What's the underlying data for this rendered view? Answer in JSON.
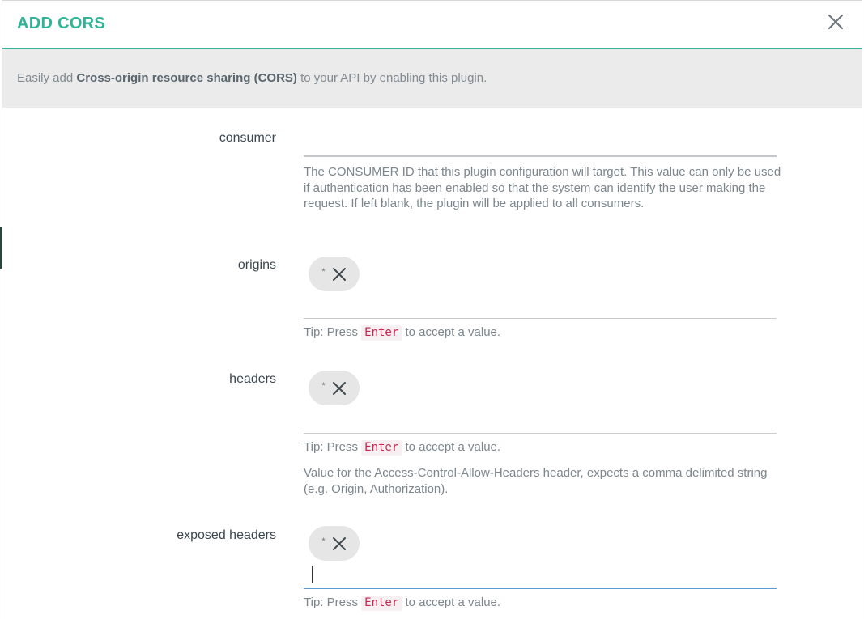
{
  "modal": {
    "title": "ADD CORS",
    "close_icon": "close-icon"
  },
  "intro": {
    "prefix": "Easily add ",
    "highlight": "Cross-origin resource sharing (CORS)",
    "suffix": " to your API by enabling this plugin."
  },
  "fields": {
    "consumer": {
      "label": "consumer",
      "value": "",
      "help": "The CONSUMER ID that this plugin configuration will target. This value can only be used if authentication has been enabled so that the system can identify the user making the request. If left blank, the plugin will be applied to all consumers."
    },
    "origins": {
      "label": "origins",
      "tag": "*",
      "tip_prefix": "Tip: Press ",
      "tip_key": "Enter",
      "tip_suffix": " to accept a value."
    },
    "headers": {
      "label": "headers",
      "tag": "*",
      "tip_prefix": "Tip: Press ",
      "tip_key": "Enter",
      "tip_suffix": " to accept a value.",
      "help": "Value for the Access-Control-Allow-Headers header, expects a comma delimited string (e.g. Origin, Authorization)."
    },
    "exposed_headers": {
      "label": "exposed headers",
      "tag": "*",
      "tip_prefix": "Tip: Press ",
      "tip_key": "Enter",
      "tip_suffix": " to accept a value."
    }
  },
  "colors": {
    "accent": "#2fb596",
    "header_rule": "#3bb59a",
    "focus": "#5b9bd5",
    "kbd_text": "#c7254e"
  }
}
